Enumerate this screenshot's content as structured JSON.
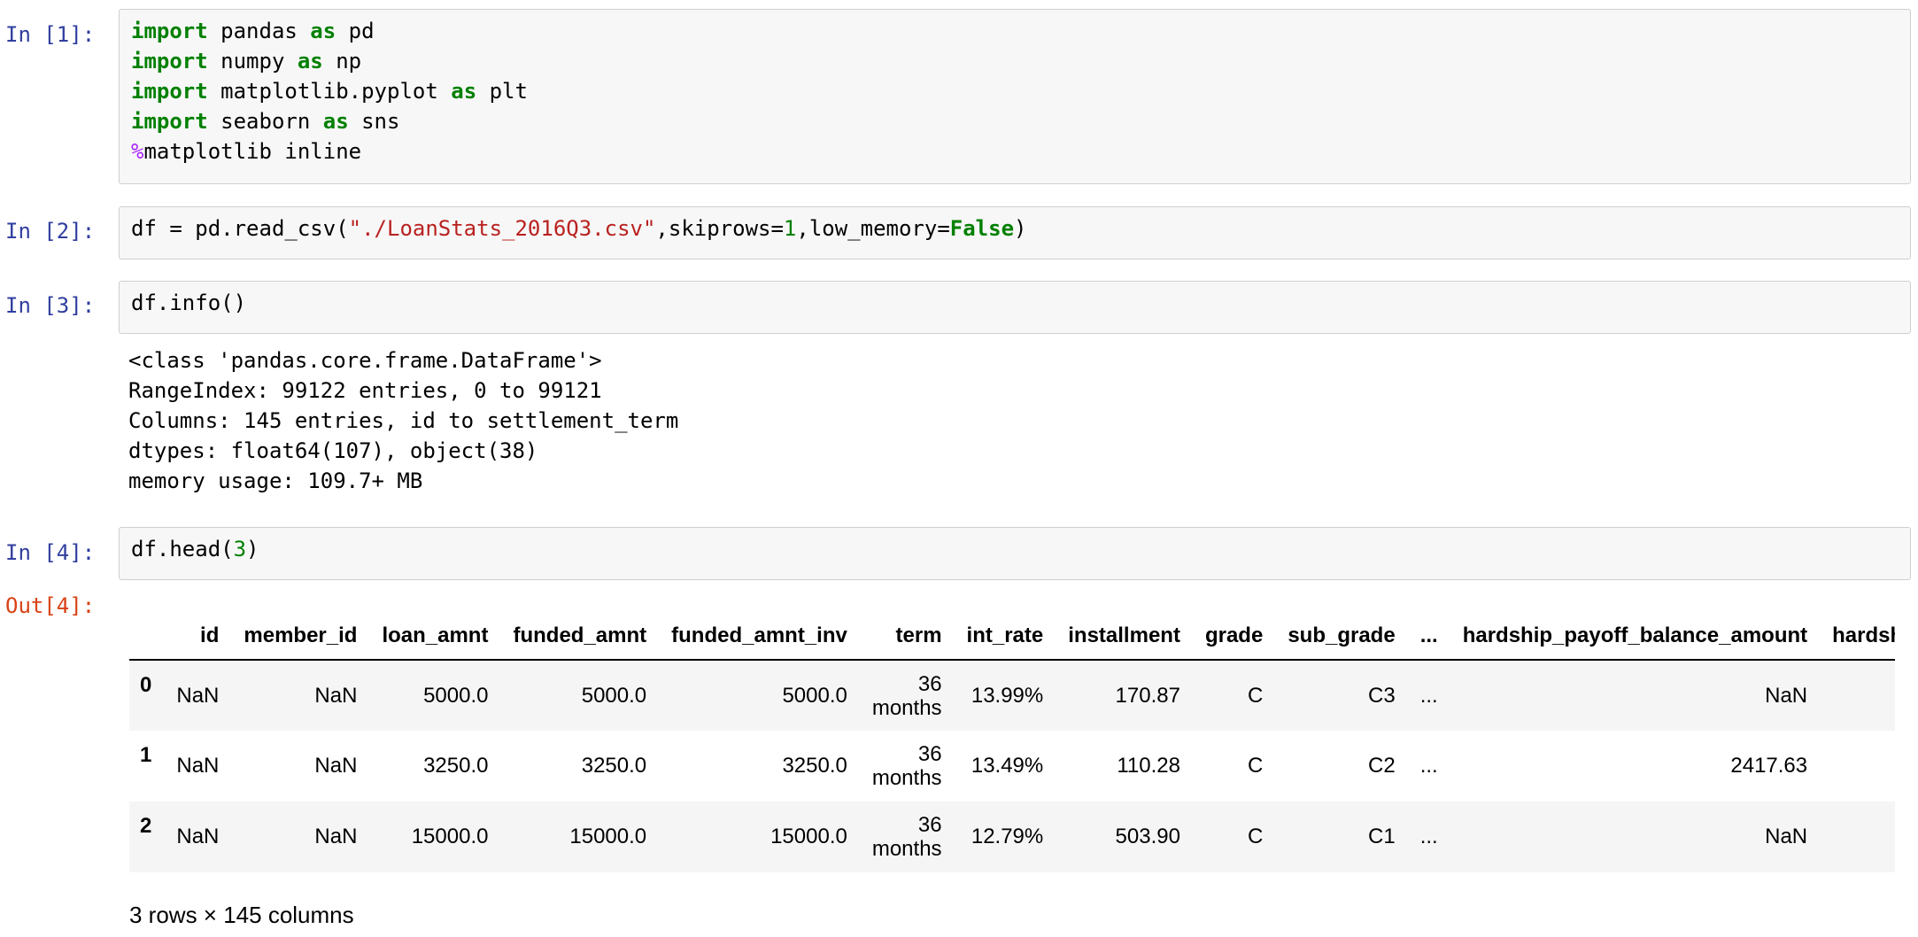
{
  "cells": [
    {
      "prompt": "In [1]:",
      "code_lines": [
        [
          {
            "t": "import",
            "c": "kw"
          },
          {
            "t": " pandas "
          },
          {
            "t": "as",
            "c": "kw"
          },
          {
            "t": " pd"
          }
        ],
        [
          {
            "t": "import",
            "c": "kw"
          },
          {
            "t": " numpy "
          },
          {
            "t": "as",
            "c": "kw"
          },
          {
            "t": " np"
          }
        ],
        [
          {
            "t": "import",
            "c": "kw"
          },
          {
            "t": " matplotlib.pyplot "
          },
          {
            "t": "as",
            "c": "kw"
          },
          {
            "t": " plt"
          }
        ],
        [
          {
            "t": "import",
            "c": "kw"
          },
          {
            "t": " seaborn "
          },
          {
            "t": "as",
            "c": "kw"
          },
          {
            "t": " sns"
          }
        ],
        [
          {
            "t": "%",
            "c": "magic"
          },
          {
            "t": "matplotlib inline"
          }
        ]
      ]
    },
    {
      "prompt": "In [2]:",
      "code_lines": [
        [
          {
            "t": "df = pd.read_csv("
          },
          {
            "t": "\"./LoanStats_2016Q3.csv\"",
            "c": "str"
          },
          {
            "t": ",skiprows="
          },
          {
            "t": "1",
            "c": "num"
          },
          {
            "t": ",low_memory="
          },
          {
            "t": "False",
            "c": "kw"
          },
          {
            "t": ")"
          }
        ]
      ]
    },
    {
      "prompt": "In [3]:",
      "code_lines": [
        [
          {
            "t": "df.info()"
          }
        ]
      ],
      "stdout": "<class 'pandas.core.frame.DataFrame'>\nRangeIndex: 99122 entries, 0 to 99121\nColumns: 145 entries, id to settlement_term\ndtypes: float64(107), object(38)\nmemory usage: 109.7+ MB"
    },
    {
      "prompt": "In [4]:",
      "code_lines": [
        [
          {
            "t": "df.head("
          },
          {
            "t": "3",
            "c": "num"
          },
          {
            "t": ")"
          }
        ]
      ],
      "out_prompt": "Out[4]:"
    }
  ],
  "dataframe": {
    "columns": [
      "",
      "id",
      "member_id",
      "loan_amnt",
      "funded_amnt",
      "funded_amnt_inv",
      "term",
      "int_rate",
      "installment",
      "grade",
      "sub_grade",
      "...",
      "hardship_payoff_balance_amount",
      "hardship_"
    ],
    "rows": [
      {
        "index": "0",
        "cells": [
          "NaN",
          "NaN",
          "5000.0",
          "5000.0",
          "5000.0",
          "36 months",
          "13.99%",
          "170.87",
          "C",
          "C3",
          "...",
          "NaN",
          ""
        ]
      },
      {
        "index": "1",
        "cells": [
          "NaN",
          "NaN",
          "3250.0",
          "3250.0",
          "3250.0",
          "36 months",
          "13.49%",
          "110.28",
          "C",
          "C2",
          "...",
          "2417.63",
          ""
        ]
      },
      {
        "index": "2",
        "cells": [
          "NaN",
          "NaN",
          "15000.0",
          "15000.0",
          "15000.0",
          "36 months",
          "12.79%",
          "503.90",
          "C",
          "C1",
          "...",
          "NaN",
          ""
        ]
      }
    ],
    "shape_text": "3 rows × 145 columns"
  }
}
